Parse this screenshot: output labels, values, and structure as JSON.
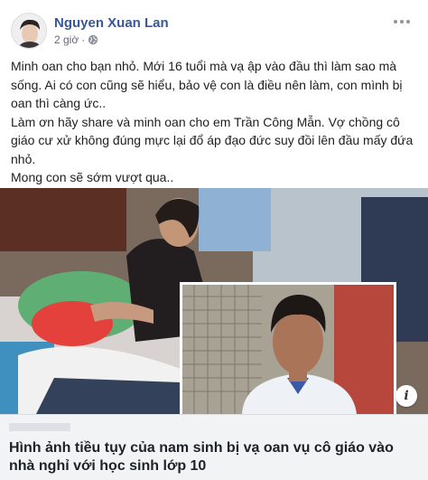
{
  "post": {
    "author": "Nguyen Xuan Lan",
    "time": "2 giờ",
    "dot": "·",
    "privacy_icon": "globe-icon",
    "more_icon": "more-dots-icon",
    "paragraphs": [
      "Minh oan cho bạn nhỏ. Mới 16 tuổi mà vạ ập vào đầu thì làm sao mà sống. Ai có con cũng sẽ hiểu, bảo vệ con là điều nên làm, con mình bị oan thì càng ức..",
      "Làm ơn hãy share và minh oan cho em Trần Công Mẫn. Vợ chồng cô giáo cư xử không đúng mực lại đổ áp đạo đức suy đồi lên đầu mấy đứa nhỏ.",
      "Mong con sẽ sớm vượt qua.."
    ]
  },
  "link_preview": {
    "title": "Hình ảnh tiều tụy của nam sinh bị vạ oan vụ cô giáo vào nhà nghỉ với học sinh lớp 10",
    "info_icon": "info-icon",
    "info_glyph": "i"
  },
  "colors": {
    "author": "#385898",
    "link_bg": "#f2f3f5",
    "text": "#1c1e21"
  }
}
